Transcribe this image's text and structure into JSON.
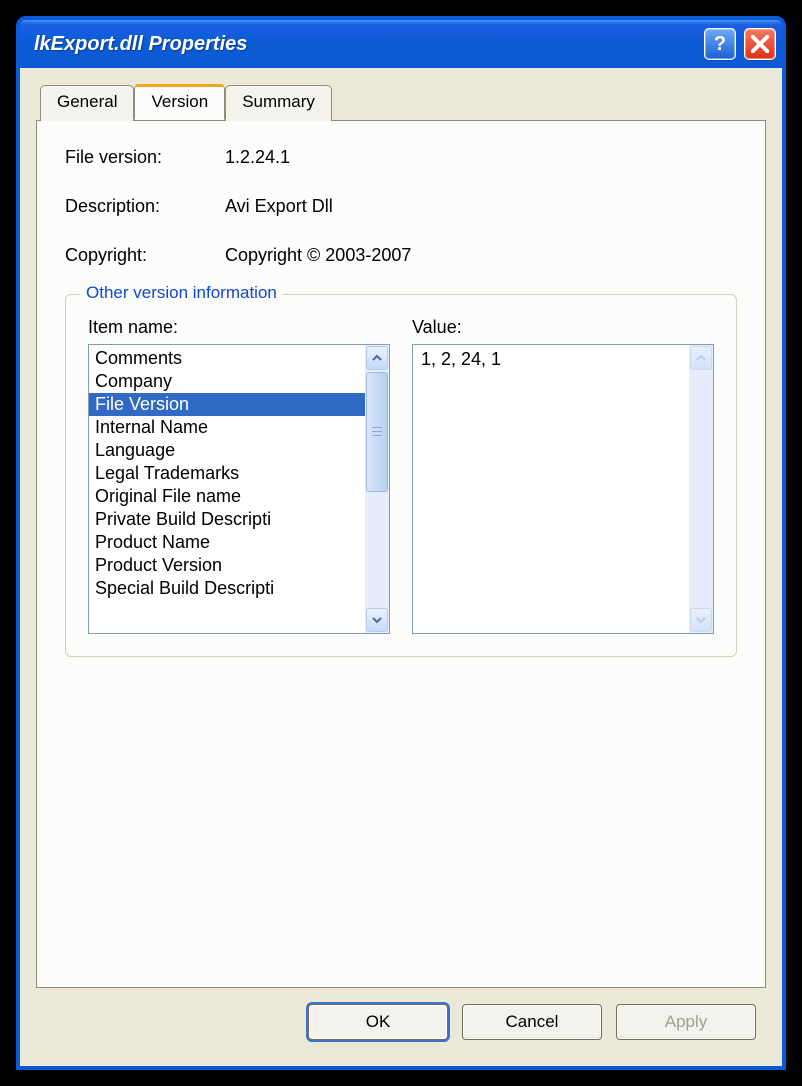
{
  "window": {
    "title": "lkExport.dll Properties"
  },
  "tabs": {
    "general": "General",
    "version": "Version",
    "summary": "Summary"
  },
  "fields": {
    "file_version_label": "File version:",
    "file_version_value": "1.2.24.1",
    "description_label": "Description:",
    "description_value": "Avi Export Dll",
    "copyright_label": "Copyright:",
    "copyright_value": "Copyright © 2003-2007"
  },
  "groupbox": {
    "legend": "Other version information",
    "item_name_label": "Item name:",
    "value_label": "Value:",
    "items": [
      "Comments",
      "Company",
      "File Version",
      "Internal Name",
      "Language",
      "Legal Trademarks",
      "Original File name",
      "Private Build Descripti",
      "Product Name",
      "Product Version",
      "Special Build Descripti"
    ],
    "selected_index": 2,
    "value_text": "1, 2, 24, 1"
  },
  "buttons": {
    "ok": "OK",
    "cancel": "Cancel",
    "apply": "Apply"
  }
}
